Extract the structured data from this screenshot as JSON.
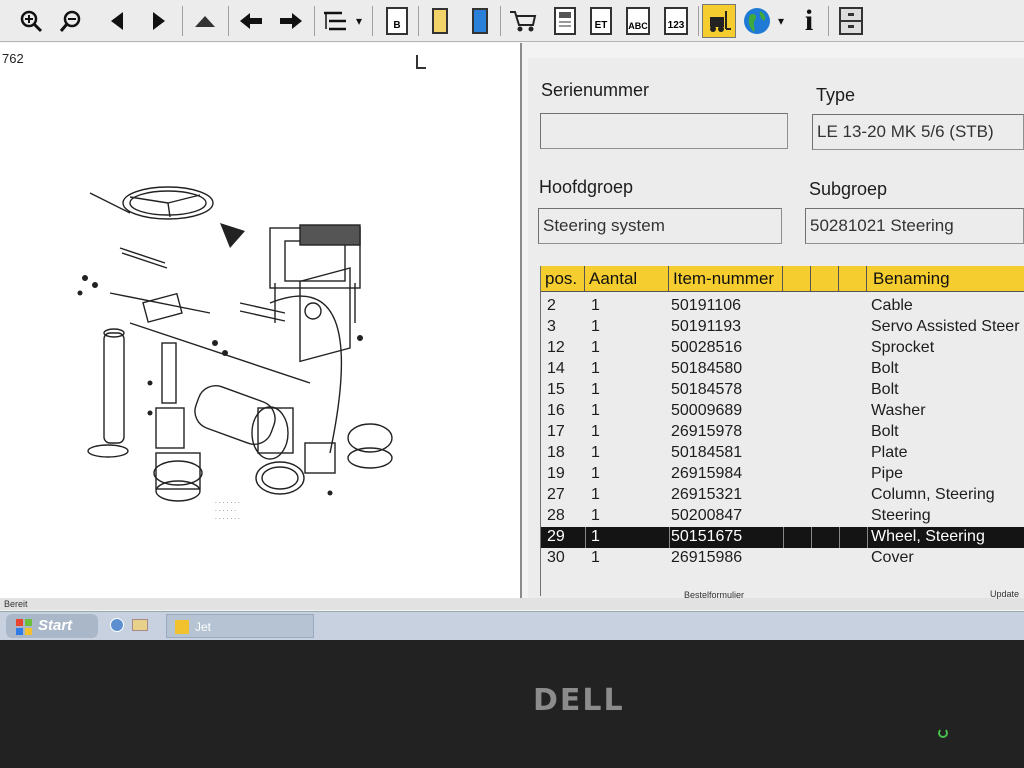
{
  "toolbar": {
    "zoom_in": "zoom-in-icon",
    "zoom_out": "zoom-out-icon",
    "doc_b_label": "B",
    "doc_et_label": "ET",
    "doc_abc_label": "ABC",
    "doc_123_label": "123",
    "info_label": "i",
    "dropdown_arrow": "▾",
    "colors": {
      "yellow": "#f2d36a",
      "blue": "#2a7fd8",
      "accent": "#f5cd2e"
    }
  },
  "left_pane": {
    "code": "762"
  },
  "form": {
    "serial_label": "Serienummer",
    "serial_value": "",
    "type_label": "Type",
    "type_value": "LE 13-20 MK 5/6 (STB)",
    "main_group_label": "Hoofdgroep",
    "main_group_value": "Steering system",
    "sub_group_label": "Subgroep",
    "sub_group_value": "50281021  Steering"
  },
  "table": {
    "columns": [
      "pos.",
      "Aantal",
      "Item-nummer",
      "",
      "",
      "",
      "Benaming"
    ],
    "rows": [
      {
        "pos": "2",
        "qty": "1",
        "item": "50191106",
        "name": "Cable"
      },
      {
        "pos": "3",
        "qty": "1",
        "item": "50191193",
        "name": "Servo Assisted Steer"
      },
      {
        "pos": "12",
        "qty": "1",
        "item": "50028516",
        "name": "Sprocket"
      },
      {
        "pos": "14",
        "qty": "1",
        "item": "50184580",
        "name": "Bolt"
      },
      {
        "pos": "15",
        "qty": "1",
        "item": "50184578",
        "name": "Bolt"
      },
      {
        "pos": "16",
        "qty": "1",
        "item": "50009689",
        "name": "Washer"
      },
      {
        "pos": "17",
        "qty": "1",
        "item": "26915978",
        "name": "Bolt"
      },
      {
        "pos": "18",
        "qty": "1",
        "item": "50184581",
        "name": "Plate"
      },
      {
        "pos": "19",
        "qty": "1",
        "item": "26915984",
        "name": "Pipe"
      },
      {
        "pos": "27",
        "qty": "1",
        "item": "26915321",
        "name": "Column, Steering"
      },
      {
        "pos": "28",
        "qty": "1",
        "item": "50200847",
        "name": "Steering"
      },
      {
        "pos": "29",
        "qty": "1",
        "item": "50151675",
        "name": "Wheel, Steering",
        "selected": true
      },
      {
        "pos": "30",
        "qty": "1",
        "item": "26915986",
        "name": "Cover"
      }
    ]
  },
  "status": {
    "left": "Bereit",
    "order_form": "Bestelformulier",
    "update": "Update"
  },
  "taskbar": {
    "start_label": "Start",
    "app_label": "Jet"
  },
  "bezel": {
    "brand": "DELL"
  }
}
